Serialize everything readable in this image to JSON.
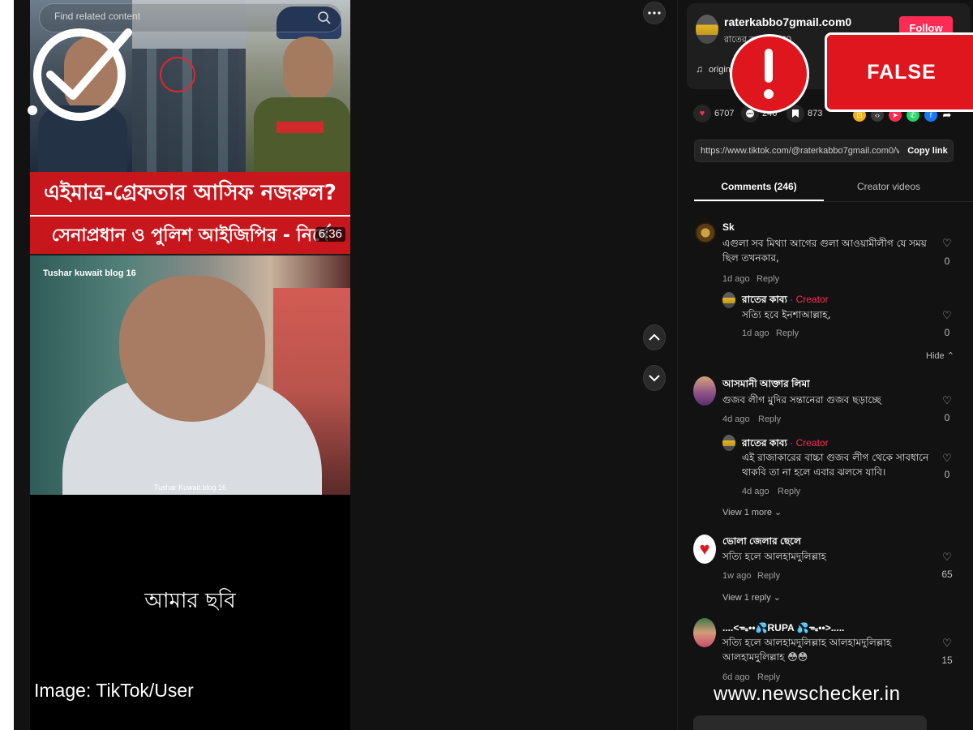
{
  "search": {
    "placeholder": "Find related content"
  },
  "thumbnail": {
    "headline_line1": "এইমাত্র-গ্রেফতার আসিফ নজরুল?",
    "headline_line2": "সেনাপ্রধান ও পুলিশ আইজিপির - নির্দে",
    "duration": "6:36"
  },
  "video": {
    "caption_top": "Tushar kuwait blog 16",
    "caption_bottom": "Tushar Kuwait blog 16",
    "bottom_caption": "আমার ছবি"
  },
  "image_credit": "Image: TikTok/User",
  "author": {
    "username": "raterkabbo7gmail.com0",
    "subtitle": "রাতের কা... · 9-20",
    "follow_label": "Follow",
    "music": "original sound"
  },
  "stats": {
    "likes": "6707",
    "comments": "246",
    "saves": "873"
  },
  "link": {
    "url": "https://www.tiktok.com/@raterkabbo7gmail.com0/vid...",
    "copy_label": "Copy link"
  },
  "tabs": {
    "comments": "Comments (246)",
    "creator_videos": "Creator videos"
  },
  "comments": [
    {
      "name": "Sk",
      "text": "এগুলা সব মিথ্যা আগের গুলা আওয়ামীলীগ যে সময় ছিল তখনকার,",
      "time": "1d ago",
      "reply": "Reply",
      "likes": "0"
    },
    {
      "name": "রাতের কাব্য",
      "creator": "· Creator",
      "text": "সত্যি হবে ইনশাআল্লাহ,",
      "time": "1d ago",
      "reply": "Reply",
      "likes": "0"
    },
    {
      "name": "আসমানী আক্তার লিমা",
      "text": "গুজব লীগ মুদির সন্তানেরা গুজব ছড়াচ্ছে",
      "time": "4d ago",
      "reply": "Reply",
      "likes": "0"
    },
    {
      "name": "রাতের কাব্য",
      "creator": "· Creator",
      "text": "এই রাজাকারের বাচ্চা গুজব লীগ থেকে সাবধানে থাকবি তা না হলে এবার ঝলসে যাবি।",
      "time": "4d ago",
      "reply": "Reply",
      "likes": "0"
    },
    {
      "name": "ভোলা জেলার ছেলে",
      "text": "সত্যি হলে আলহামদুলিল্লাহ",
      "time": "1w ago",
      "reply": "Reply",
      "likes": "65"
    },
    {
      "name": "....<ᯓ••💦RUPA 💦ᯓ••>.....",
      "text": "সত্যি হলে আলহামদুলিল্লাহ আলহামদুলিল্লাহ আলহামদুলিল্লাহ 😳😳",
      "time": "6d ago",
      "reply": "Reply",
      "likes": "15"
    }
  ],
  "hide_label": "Hide",
  "view_more_1": "View 1 more",
  "view_reply_1": "View 1 reply",
  "badge": {
    "label": "FALSE"
  },
  "watermark": "www.newschecker.in",
  "colors": {
    "accent": "#fe2c55",
    "badge_red": "#e0161e",
    "panel_bg": "#121212"
  }
}
